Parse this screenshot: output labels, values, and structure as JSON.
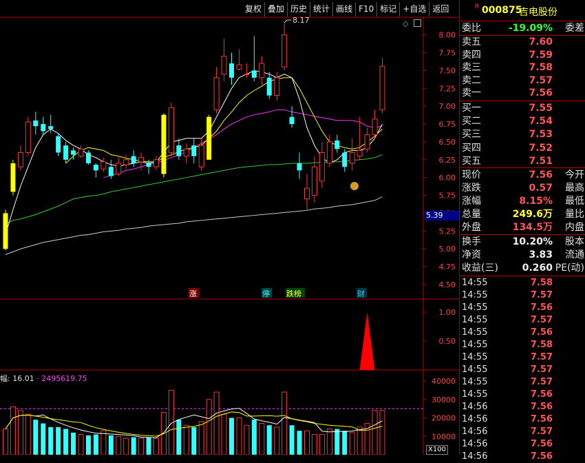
{
  "toolbar": {
    "items": [
      "复权",
      "叠加",
      "历史",
      "统计",
      "画线",
      "F10",
      "标记",
      "+自选",
      "返回"
    ]
  },
  "chart": {
    "price_axis_ticks": [
      "8.00",
      "7.75",
      "7.50",
      "7.25",
      "7.00",
      "6.75",
      "6.50",
      "6.25",
      "6.00",
      "5.75",
      "5.50",
      "5.25",
      "5.00",
      "4.75",
      "4.50"
    ],
    "high_label": "8.17",
    "cursor_price": "5.39",
    "indicator_ticks": [
      "1.00",
      "0.50"
    ],
    "volume_ticks": [
      "40000",
      "30000",
      "20000",
      "10000"
    ],
    "volume_unit": "X100",
    "volume_info": "幅: 16.01 · 2495619.75",
    "event_tags": [
      "涨",
      "停",
      "跌榜",
      "财"
    ],
    "colors": {
      "up": "#ff3333",
      "down": "#33ffff",
      "highlight": "#ffff00",
      "ma5": "#ffffff",
      "ma10": "#ffff00",
      "ma20": "#ff33ff",
      "ma60": "#33cc33",
      "ma120": "#cccccc"
    }
  },
  "chart_data": {
    "type": "candlestick",
    "ylim": [
      4.5,
      8.17
    ],
    "candles": [
      {
        "o": 5.0,
        "c": 5.5,
        "h": 5.55,
        "l": 4.98
      },
      {
        "o": 5.8,
        "c": 6.2,
        "h": 6.25,
        "l": 5.75
      },
      {
        "o": 6.15,
        "c": 6.35,
        "h": 6.45,
        "l": 6.1
      },
      {
        "o": 6.35,
        "c": 6.78,
        "h": 6.85,
        "l": 6.3
      },
      {
        "o": 6.8,
        "c": 6.72,
        "h": 6.92,
        "l": 6.6
      },
      {
        "o": 6.75,
        "c": 6.65,
        "h": 6.85,
        "l": 6.6
      },
      {
        "o": 6.72,
        "c": 6.68,
        "h": 6.88,
        "l": 6.62
      },
      {
        "o": 6.58,
        "c": 6.35,
        "h": 6.62,
        "l": 6.3
      },
      {
        "o": 6.45,
        "c": 6.25,
        "h": 6.5,
        "l": 6.2
      },
      {
        "o": 6.38,
        "c": 6.32,
        "h": 6.42,
        "l": 6.25
      },
      {
        "o": 6.3,
        "c": 6.4,
        "h": 6.45,
        "l": 6.28
      },
      {
        "o": 6.35,
        "c": 6.2,
        "h": 6.38,
        "l": 6.18
      },
      {
        "o": 6.18,
        "c": 6.1,
        "h": 6.2,
        "l": 6.0
      },
      {
        "o": 6.12,
        "c": 6.22,
        "h": 6.28,
        "l": 6.08
      },
      {
        "o": 6.15,
        "c": 6.02,
        "h": 6.25,
        "l": 5.98
      },
      {
        "o": 6.05,
        "c": 6.2,
        "h": 6.28,
        "l": 6.02
      },
      {
        "o": 6.18,
        "c": 6.25,
        "h": 6.32,
        "l": 6.12
      },
      {
        "o": 6.3,
        "c": 6.2,
        "h": 6.38,
        "l": 6.15
      },
      {
        "o": 6.22,
        "c": 6.28,
        "h": 6.35,
        "l": 6.1
      },
      {
        "o": 6.2,
        "c": 6.15,
        "h": 6.25,
        "l": 6.05
      },
      {
        "o": 6.15,
        "c": 6.25,
        "h": 6.3,
        "l": 6.1
      },
      {
        "o": 6.05,
        "c": 6.88,
        "h": 6.9,
        "l": 6.0
      },
      {
        "o": 6.35,
        "c": 6.98,
        "h": 7.05,
        "l": 6.3
      },
      {
        "o": 6.45,
        "c": 6.3,
        "h": 6.55,
        "l": 6.25
      },
      {
        "o": 6.3,
        "c": 6.4,
        "h": 6.48,
        "l": 6.2
      },
      {
        "o": 6.45,
        "c": 6.3,
        "h": 6.55,
        "l": 6.2
      },
      {
        "o": 6.15,
        "c": 6.45,
        "h": 6.55,
        "l": 6.1
      },
      {
        "o": 6.25,
        "c": 6.85,
        "h": 6.88,
        "l": 6.25
      },
      {
        "o": 6.95,
        "c": 7.4,
        "h": 7.55,
        "l": 6.9
      },
      {
        "o": 7.45,
        "c": 7.7,
        "h": 7.95,
        "l": 7.35
      },
      {
        "o": 7.6,
        "c": 7.4,
        "h": 7.75,
        "l": 7.3
      },
      {
        "o": 7.52,
        "c": 7.58,
        "h": 7.8,
        "l": 7.5
      },
      {
        "o": 7.45,
        "c": 7.45,
        "h": 7.6,
        "l": 7.4
      },
      {
        "o": 7.5,
        "c": 7.4,
        "h": 7.98,
        "l": 7.35
      },
      {
        "o": 7.4,
        "c": 7.6,
        "h": 7.7,
        "l": 7.3
      },
      {
        "o": 7.4,
        "c": 7.15,
        "h": 7.48,
        "l": 7.1
      },
      {
        "o": 7.15,
        "c": 7.4,
        "h": 7.48,
        "l": 7.08
      },
      {
        "o": 7.55,
        "c": 8.0,
        "h": 8.17,
        "l": 7.5
      },
      {
        "o": 6.85,
        "c": 6.75,
        "h": 7.0,
        "l": 6.7
      },
      {
        "o": 6.2,
        "c": 6.1,
        "h": 6.35,
        "l": 5.98
      },
      {
        "o": 5.7,
        "c": 5.85,
        "h": 6.05,
        "l": 5.55
      },
      {
        "o": 5.75,
        "c": 6.15,
        "h": 6.3,
        "l": 5.65
      },
      {
        "o": 5.95,
        "c": 6.35,
        "h": 6.5,
        "l": 5.85
      },
      {
        "o": 6.2,
        "c": 6.5,
        "h": 6.6,
        "l": 6.15
      },
      {
        "o": 6.52,
        "c": 6.4,
        "h": 6.6,
        "l": 6.35
      },
      {
        "o": 6.35,
        "c": 6.15,
        "h": 6.4,
        "l": 6.08
      },
      {
        "o": 6.2,
        "c": 6.35,
        "h": 6.55,
        "l": 6.1
      },
      {
        "o": 6.3,
        "c": 6.38,
        "h": 6.85,
        "l": 6.25
      },
      {
        "o": 6.4,
        "c": 6.6,
        "h": 6.7,
        "l": 6.35
      },
      {
        "o": 6.6,
        "c": 6.82,
        "h": 6.95,
        "l": 6.55
      },
      {
        "o": 6.95,
        "c": 7.56,
        "h": 7.68,
        "l": 6.9
      }
    ],
    "highlight_index": [
      0,
      1,
      21,
      27
    ],
    "ma5": [
      5.2,
      5.55,
      5.88,
      6.15,
      6.42,
      6.6,
      6.68,
      6.62,
      6.52,
      6.45,
      6.4,
      6.32,
      6.28,
      6.22,
      6.18,
      6.16,
      6.18,
      6.2,
      6.22,
      6.2,
      6.22,
      6.35,
      6.5,
      6.52,
      6.55,
      6.55,
      6.55,
      6.65,
      6.85,
      7.05,
      7.25,
      7.4,
      7.45,
      7.5,
      7.48,
      7.45,
      7.4,
      7.45,
      7.4,
      7.1,
      6.7,
      6.45,
      6.28,
      6.2,
      6.25,
      6.35,
      6.38,
      6.38,
      6.42,
      6.55,
      6.75
    ],
    "ma10": [
      null,
      null,
      null,
      null,
      null,
      null,
      null,
      null,
      6.2,
      6.3,
      6.38,
      6.42,
      6.4,
      6.38,
      6.32,
      6.3,
      6.27,
      6.25,
      6.23,
      6.22,
      6.22,
      6.28,
      6.32,
      6.36,
      6.4,
      6.42,
      6.45,
      6.55,
      6.65,
      6.8,
      6.92,
      7.05,
      7.15,
      7.22,
      7.28,
      7.35,
      7.38,
      7.4,
      7.4,
      7.25,
      7.05,
      6.85,
      6.65,
      6.5,
      6.45,
      6.42,
      6.4,
      6.42,
      6.5,
      6.58,
      6.68
    ],
    "ma20": [
      null,
      null,
      null,
      null,
      null,
      null,
      null,
      null,
      null,
      null,
      null,
      null,
      null,
      6.0,
      6.03,
      6.06,
      6.1,
      6.12,
      6.15,
      6.18,
      6.2,
      6.24,
      6.28,
      6.32,
      6.36,
      6.42,
      6.48,
      6.54,
      6.6,
      6.68,
      6.75,
      6.8,
      6.85,
      6.88,
      6.9,
      6.92,
      6.95,
      6.95,
      6.92,
      6.9,
      6.88,
      6.86,
      6.84,
      6.82,
      6.8,
      6.8,
      6.8,
      6.78,
      6.72,
      6.7,
      6.72
    ],
    "ma60": [
      5.35,
      5.4,
      5.42,
      5.45,
      5.48,
      5.52,
      5.56,
      5.6,
      5.65,
      5.7,
      5.72,
      5.74,
      5.75,
      5.77,
      5.8,
      5.82,
      5.84,
      5.86,
      5.88,
      5.9,
      5.92,
      5.94,
      5.96,
      5.98,
      6.0,
      6.02,
      6.04,
      6.06,
      6.08,
      6.1,
      6.12,
      6.14,
      6.15,
      6.16,
      6.17,
      6.18,
      6.18,
      6.19,
      6.2,
      6.2,
      6.2,
      6.21,
      6.21,
      6.22,
      6.22,
      6.23,
      6.24,
      6.25,
      6.26,
      6.28,
      6.32
    ],
    "ma120": [
      4.92,
      4.96,
      5.0,
      5.03,
      5.06,
      5.09,
      5.11,
      5.13,
      5.15,
      5.17,
      5.19,
      5.2,
      5.22,
      5.24,
      5.25,
      5.26,
      5.28,
      5.29,
      5.3,
      5.32,
      5.33,
      5.34,
      5.35,
      5.36,
      5.38,
      5.39,
      5.4,
      5.41,
      5.42,
      5.43,
      5.44,
      5.45,
      5.46,
      5.47,
      5.48,
      5.49,
      5.5,
      5.51,
      5.52,
      5.53,
      5.54,
      5.56,
      5.57,
      5.58,
      5.6,
      5.61,
      5.62,
      5.64,
      5.66,
      5.68,
      5.73
    ],
    "indicator": {
      "spike_index": 48,
      "spike_value": 1.0
    },
    "volume": [
      14000,
      26000,
      24000,
      22000,
      19000,
      17000,
      15000,
      15000,
      14000,
      12000,
      11000,
      10500,
      11000,
      13000,
      10500,
      10000,
      9000,
      9500,
      9000,
      9500,
      9000,
      23000,
      35000,
      19000,
      16000,
      15000,
      18000,
      30000,
      34000,
      22000,
      20000,
      20000,
      16000,
      19000,
      17000,
      16000,
      15000,
      34000,
      16000,
      13000,
      13000,
      11000,
      11000,
      14000,
      14000,
      13000,
      12000,
      15000,
      17000,
      24000,
      24000
    ]
  },
  "panel": {
    "stock_code": "000875",
    "stock_name": "吉电股份",
    "weibi_label": "委比",
    "weibi_value": "-19.09%",
    "weicha_label": "委差",
    "sell": [
      {
        "label": "卖五",
        "price": "7.60"
      },
      {
        "label": "卖四",
        "price": "7.59"
      },
      {
        "label": "卖三",
        "price": "7.58"
      },
      {
        "label": "卖二",
        "price": "7.57"
      },
      {
        "label": "卖一",
        "price": "7.56"
      }
    ],
    "buy": [
      {
        "label": "买一",
        "price": "7.55"
      },
      {
        "label": "买二",
        "price": "7.54"
      },
      {
        "label": "买三",
        "price": "7.53"
      },
      {
        "label": "买四",
        "price": "7.52"
      },
      {
        "label": "买五",
        "price": "7.51"
      }
    ],
    "quote": [
      {
        "label": "现价",
        "value": "7.56",
        "right": "今开"
      },
      {
        "label": "涨跌",
        "value": "0.57",
        "right": "最高"
      },
      {
        "label": "涨幅",
        "value": "8.15%",
        "right": "最低"
      },
      {
        "label": "总量",
        "value": "249.6万",
        "right": "量比"
      },
      {
        "label": "外盘",
        "value": "134.5万",
        "right": "内盘"
      }
    ],
    "fund": [
      {
        "label": "换手",
        "value": "10.20%",
        "right": "股本"
      },
      {
        "label": "净资",
        "value": "3.83",
        "right": "流通"
      },
      {
        "label": "收益(三)",
        "value": "0.260",
        "right": "PE(动)"
      }
    ],
    "ticks": [
      {
        "time": "14:55",
        "price": "7.58"
      },
      {
        "time": "14:55",
        "price": "7.57"
      },
      {
        "time": "14:55",
        "price": "7.56"
      },
      {
        "time": "14:55",
        "price": "7.57"
      },
      {
        "time": "14:55",
        "price": "7.56"
      },
      {
        "time": "14:55",
        "price": "7.58"
      },
      {
        "time": "14:55",
        "price": "7.57"
      },
      {
        "time": "14:55",
        "price": "7.57"
      },
      {
        "time": "14:55",
        "price": "7.57"
      },
      {
        "time": "14:55",
        "price": "7.56"
      },
      {
        "time": "14:56",
        "price": "7.56"
      },
      {
        "time": "14:56",
        "price": "7.56"
      },
      {
        "time": "14:56",
        "price": "7.57"
      },
      {
        "time": "14:56",
        "price": "7.56"
      },
      {
        "time": "14:56",
        "price": "7.56"
      }
    ]
  }
}
